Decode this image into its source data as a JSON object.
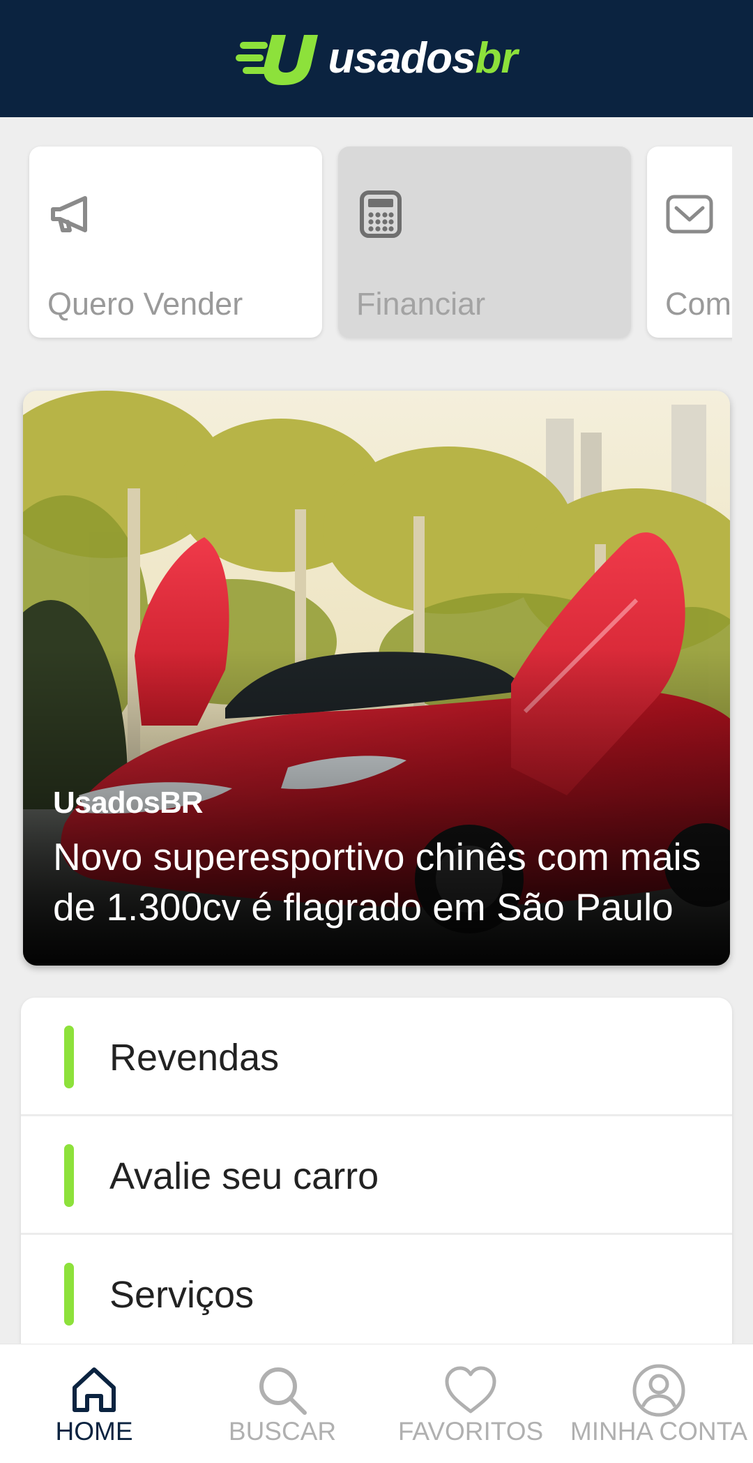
{
  "header": {
    "logo_usados": "usados",
    "logo_br": "br",
    "colors": {
      "background": "#0b2340",
      "accent": "#8de13b"
    }
  },
  "quick_actions": [
    {
      "label": "Quero Vender",
      "icon": "megaphone-icon",
      "disabled": false
    },
    {
      "label": "Financiar",
      "icon": "calculator-icon",
      "disabled": true
    },
    {
      "label": "Comprar",
      "icon": "mail-check-icon",
      "disabled": false
    }
  ],
  "news": {
    "source": "UsadosBR",
    "title": "Novo superesportivo chinês com mais de 1.300cv é flagrado em São Paulo"
  },
  "menu": [
    {
      "label": "Revendas"
    },
    {
      "label": "Avalie seu carro"
    },
    {
      "label": "Serviços"
    }
  ],
  "bottom_nav": [
    {
      "label": "HOME",
      "icon": "home-icon",
      "active": true
    },
    {
      "label": "BUSCAR",
      "icon": "search-icon",
      "active": false
    },
    {
      "label": "FAVORITOS",
      "icon": "heart-icon",
      "active": false
    },
    {
      "label": "MINHA CONTA",
      "icon": "user-circle-icon",
      "active": false
    }
  ]
}
